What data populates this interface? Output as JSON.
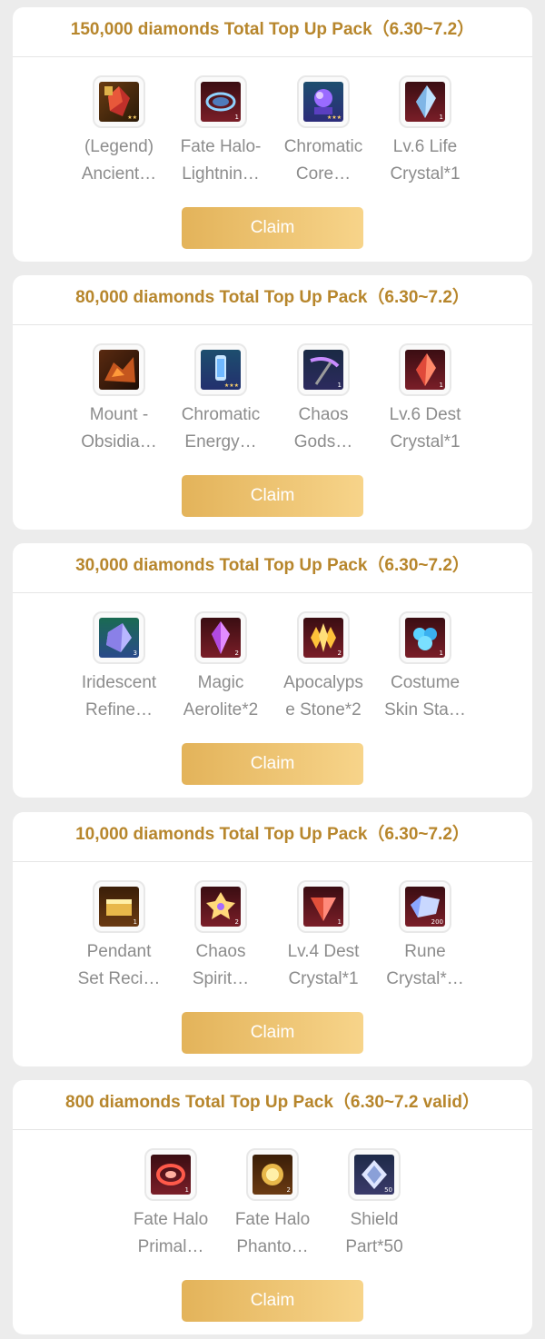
{
  "packs": [
    {
      "title": "150,000 diamonds Total Top Up Pack（6.30~7.2）",
      "claim_label": "Claim",
      "items": [
        {
          "line1": "(Legend)",
          "line2": "Ancient…",
          "icon": "legend-crystal-icon",
          "badge": "★★"
        },
        {
          "line1": "Fate Halo-",
          "line2": "Lightnin…",
          "icon": "lightning-halo-icon",
          "badge": "1"
        },
        {
          "line1": "Chromatic",
          "line2": "Core…",
          "icon": "chromatic-core-icon",
          "badge": "★★★"
        },
        {
          "line1": "Lv.6 Life",
          "line2": "Crystal*1",
          "icon": "life-crystal-icon",
          "badge": "1"
        }
      ]
    },
    {
      "title": "80,000 diamonds Total Top Up Pack（6.30~7.2）",
      "claim_label": "Claim",
      "items": [
        {
          "line1": "Mount -",
          "line2": "Obsidia…",
          "icon": "obsidian-mount-icon",
          "badge": ""
        },
        {
          "line1": "Chromatic",
          "line2": "Energy…",
          "icon": "chromatic-energy-icon",
          "badge": "★★★"
        },
        {
          "line1": "Chaos",
          "line2": "Gods…",
          "icon": "chaos-scythe-icon",
          "badge": "1"
        },
        {
          "line1": "Lv.6 Dest",
          "line2": "Crystal*1",
          "icon": "dest-crystal-icon",
          "badge": "1"
        }
      ]
    },
    {
      "title": "30,000 diamonds Total Top Up Pack（6.30~7.2）",
      "claim_label": "Claim",
      "items": [
        {
          "line1": "Iridescent",
          "line2": "Refine…",
          "icon": "iridescent-stone-icon",
          "badge": "3"
        },
        {
          "line1": "Magic",
          "line2": "Aerolite*2",
          "icon": "magic-aerolite-icon",
          "badge": "2"
        },
        {
          "line1": "Apocalyps",
          "line2": "e Stone*2",
          "icon": "apocalypse-stone-icon",
          "badge": "2"
        },
        {
          "line1": "Costume",
          "line2": "Skin Sta…",
          "icon": "costume-skin-stone-icon",
          "badge": "1"
        }
      ]
    },
    {
      "title": "10,000 diamonds Total Top Up Pack（6.30~7.2）",
      "claim_label": "Claim",
      "items": [
        {
          "line1": "Pendant",
          "line2": "Set Reci…",
          "icon": "recipe-scroll-icon",
          "badge": "1"
        },
        {
          "line1": "Chaos",
          "line2": "Spirit…",
          "icon": "chaos-spirit-icon",
          "badge": "2"
        },
        {
          "line1": "Lv.4 Dest",
          "line2": "Crystal*1",
          "icon": "dest-crystal-lv4-icon",
          "badge": "1"
        },
        {
          "line1": "Rune",
          "line2": "Crystal*…",
          "icon": "rune-crystal-icon",
          "badge": "200"
        }
      ]
    },
    {
      "title": "800 diamonds Total Top Up Pack（6.30~7.2 valid）",
      "claim_label": "Claim",
      "items": [
        {
          "line1": "Fate Halo",
          "line2": "Primal…",
          "icon": "primal-halo-icon",
          "badge": "1"
        },
        {
          "line1": "Fate Halo",
          "line2": "Phanto…",
          "icon": "phantom-halo-icon",
          "badge": "2"
        },
        {
          "line1": "Shield",
          "line2": "Part*50",
          "icon": "shield-part-icon",
          "badge": "50"
        }
      ]
    }
  ]
}
